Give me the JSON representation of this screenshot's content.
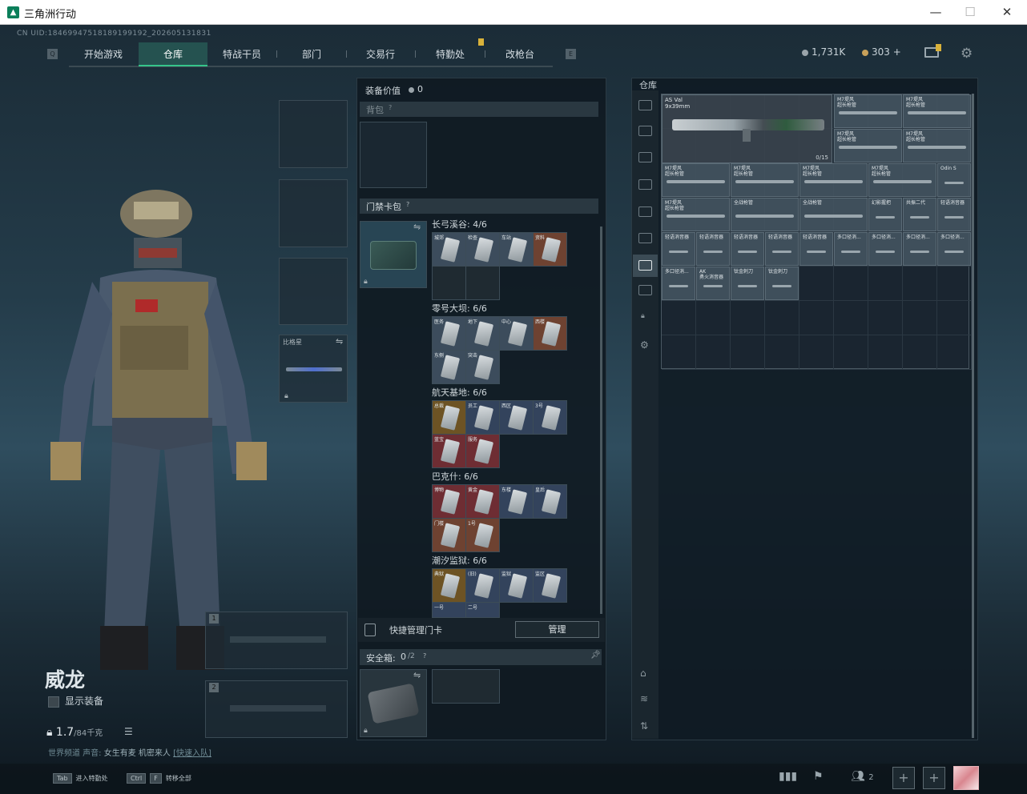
{
  "window": {
    "title": "三角洲行动",
    "minimize": "—",
    "maximize": "☐",
    "close": "✕"
  },
  "uid": "CN UID:18469947518189199192_202605131831",
  "nav": {
    "items": [
      "开始游戏",
      "仓库",
      "特战干员",
      "部门",
      "交易行",
      "特勤处",
      "改枪台"
    ],
    "active": "仓库",
    "left_key": "Q",
    "right_key": "E"
  },
  "currency": {
    "silver": "1,731K",
    "gold": "303",
    "plus": "+"
  },
  "character": {
    "name": "威龙",
    "show_equipment": "显示装备",
    "weight": "1.7",
    "weight_max": "/84千克",
    "voice_prefix": "世界频道 声音:",
    "voice_text": "女生有麦 机密来人",
    "voice_link": "[快速入队]"
  },
  "slots": {
    "melee_label": "比格星",
    "primary_1": "1",
    "primary_2": "2"
  },
  "equipment": {
    "value_label": "装备价值",
    "value": "0",
    "backpack_label": "背包",
    "keycard_label": "门禁卡包",
    "help": "?",
    "maps": [
      {
        "name": "长弓溪谷: 4/6"
      },
      {
        "name": "零号大坝: 6/6"
      },
      {
        "name": "航天基地: 6/6"
      },
      {
        "name": "巴克什: 6/6"
      },
      {
        "name": "潮汐监狱: 6/6"
      }
    ],
    "quick_manage": "快捷管理门卡",
    "manage_btn": "管理",
    "safe_label": "安全箱:",
    "safe_count": "0",
    "safe_max": "/2"
  },
  "cards": {
    "m1": [
      "城郊",
      "检查",
      "车站",
      "资料"
    ],
    "m2": [
      "医务",
      "地下",
      "中心",
      "西楼",
      "东侧",
      "突击"
    ],
    "m3": [
      "总裁",
      "员工",
      "西区",
      "3号",
      "蓝宝",
      "服务"
    ],
    "m4": [
      "博物",
      "黄金",
      "东楼",
      "皇后",
      "门楼",
      "1号"
    ],
    "m5": [
      "典狱",
      "(旧)",
      "监狱",
      "监区",
      "一号",
      "二号"
    ]
  },
  "warehouse": {
    "title": "仓库",
    "big_item": {
      "name": "AS Val\n9x39mm",
      "count": "0/15"
    },
    "items": [
      {
        "n": "M7堤风\n超长枪管"
      },
      {
        "n": "M7堤风\n超长枪管"
      },
      {
        "n": "M7堤风\n超长枪管"
      },
      {
        "n": "M7堤风\n超长枪管"
      },
      {
        "n": "M7堤风\n超长枪管"
      },
      {
        "n": "M7堤风\n超长枪管"
      },
      {
        "n": "M7堤风\n超长枪管"
      },
      {
        "n": "M7堤风\n超长枪管"
      },
      {
        "n": "Odin S"
      },
      {
        "n": "M7堤风\n超长枪管"
      },
      {
        "n": "全战枪管"
      },
      {
        "n": "全战枪管"
      },
      {
        "n": "幻影握把"
      },
      {
        "n": "共振二代"
      },
      {
        "n": "轻语消音器"
      },
      {
        "n": "轻语消音器"
      },
      {
        "n": "轻语消音器"
      },
      {
        "n": "轻语消音器"
      },
      {
        "n": "轻语消音器"
      },
      {
        "n": "轻语消音器"
      },
      {
        "n": "多口径消..."
      },
      {
        "n": "多口径消..."
      },
      {
        "n": "多口径消..."
      },
      {
        "n": "多口径消..."
      },
      {
        "n": "多口径消..."
      },
      {
        "n": "AK\n勇火消音器"
      },
      {
        "n": "钛金刺刀"
      },
      {
        "n": "钛金刺刀"
      }
    ]
  },
  "bottom": {
    "tab_key": "Tab",
    "tab_text": "进入特勤处",
    "ctrl_key": "Ctrl",
    "f_key": "F",
    "ctrl_text": "转移全部",
    "friends": "2",
    "plus": "+"
  }
}
